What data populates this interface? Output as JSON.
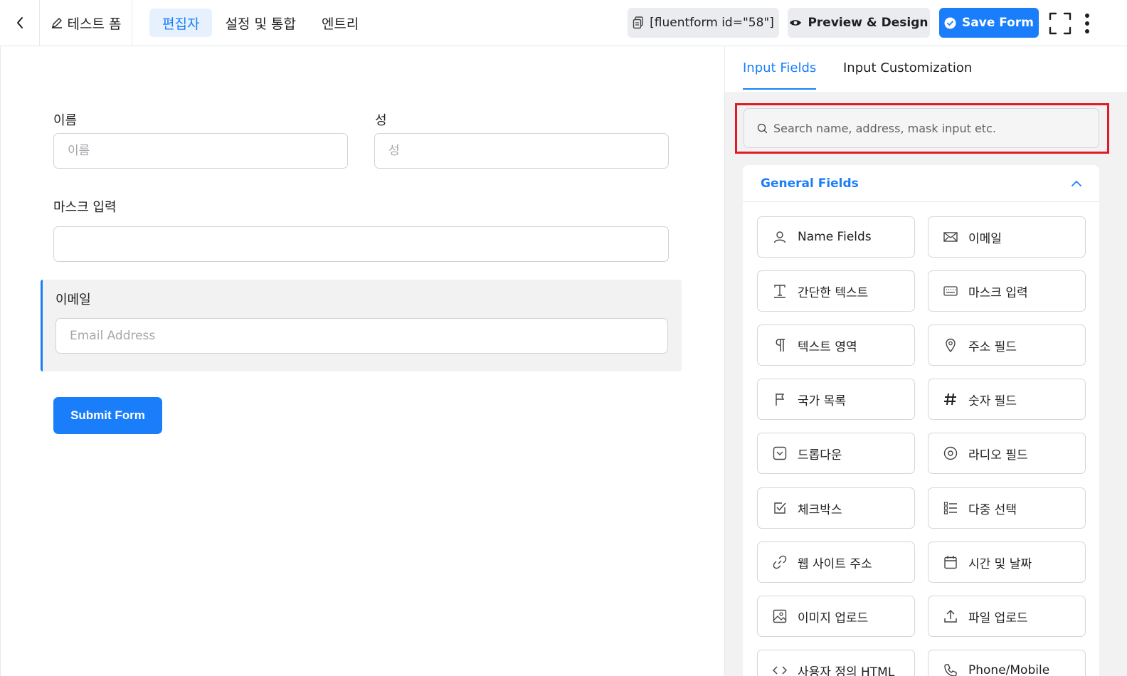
{
  "header": {
    "form_title": "테스트 폼",
    "tabs": [
      {
        "label": "편집자",
        "active": true
      },
      {
        "label": "설정 및 통합",
        "active": false
      },
      {
        "label": "엔트리",
        "active": false
      }
    ],
    "shortcode": "[fluentform id=\"58\"]",
    "preview_label": "Preview & Design",
    "save_label": "Save Form"
  },
  "form": {
    "first_name": {
      "label": "이름",
      "placeholder": "이름"
    },
    "last_name": {
      "label": "성",
      "placeholder": "성"
    },
    "mask_input": {
      "label": "마스크 입력",
      "placeholder": ""
    },
    "email": {
      "label": "이메일",
      "placeholder": "Email Address"
    },
    "submit_label": "Submit Form"
  },
  "sidebar": {
    "tabs": [
      {
        "label": "Input Fields",
        "active": true
      },
      {
        "label": "Input Customization",
        "active": false
      }
    ],
    "search_placeholder": "Search name, address, mask input etc.",
    "section_title": "General Fields",
    "fields": [
      {
        "label": "Name Fields",
        "icon": "user-icon"
      },
      {
        "label": "이메일",
        "icon": "envelope-icon"
      },
      {
        "label": "간단한 텍스트",
        "icon": "text-icon"
      },
      {
        "label": "마스크 입력",
        "icon": "keyboard-icon"
      },
      {
        "label": "텍스트 영역",
        "icon": "paragraph-icon"
      },
      {
        "label": "주소 필드",
        "icon": "map-pin-icon"
      },
      {
        "label": "국가 목록",
        "icon": "flag-icon"
      },
      {
        "label": "숫자 필드",
        "icon": "hash-icon"
      },
      {
        "label": "드롭다운",
        "icon": "dropdown-icon"
      },
      {
        "label": "라디오 필드",
        "icon": "radio-icon"
      },
      {
        "label": "체크박스",
        "icon": "checkbox-icon"
      },
      {
        "label": "다중 선택",
        "icon": "list-icon"
      },
      {
        "label": "웹 사이트 주소",
        "icon": "link-icon"
      },
      {
        "label": "시간 및 날짜",
        "icon": "calendar-icon"
      },
      {
        "label": "이미지 업로드",
        "icon": "image-icon"
      },
      {
        "label": "파일 업로드",
        "icon": "upload-icon"
      },
      {
        "label": "사용자 정의 HTML",
        "icon": "code-icon"
      },
      {
        "label": "Phone/Mobile",
        "icon": "phone-icon"
      }
    ],
    "highlight_color": "#e01b24"
  },
  "colors": {
    "accent": "#1a7efb"
  }
}
